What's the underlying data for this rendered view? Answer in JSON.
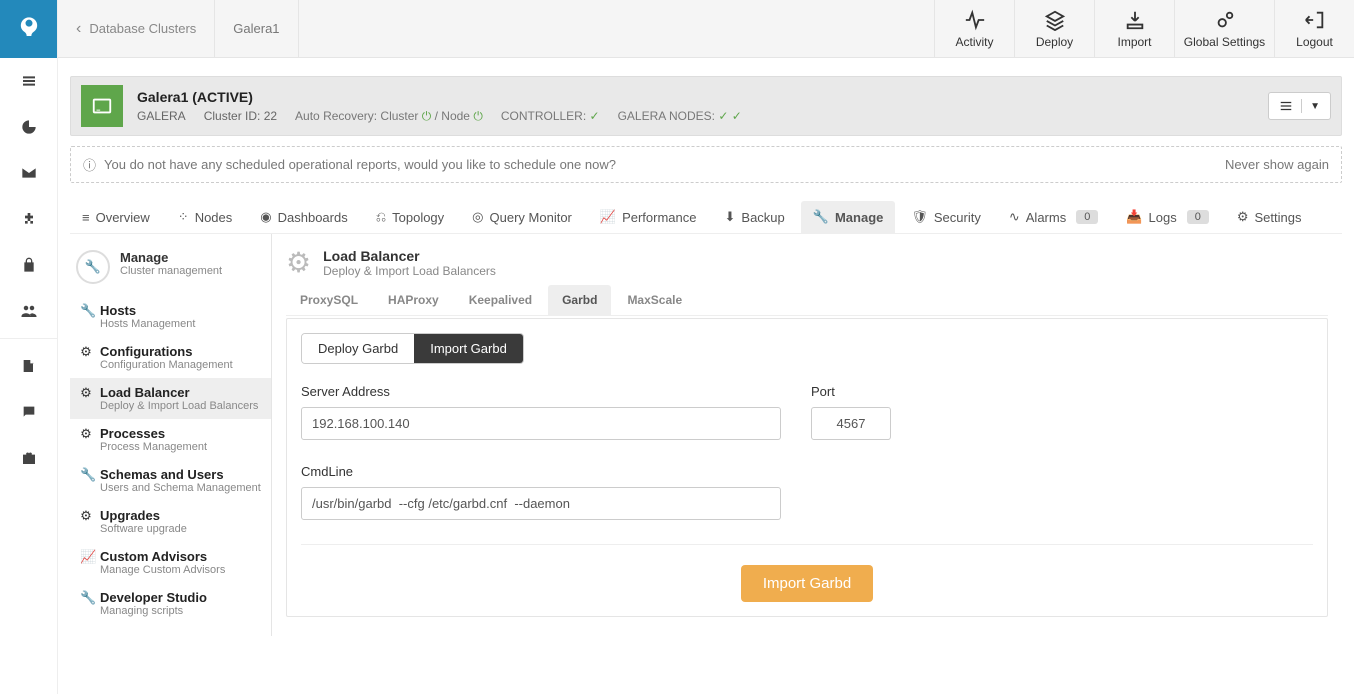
{
  "breadcrumb": {
    "root": "Database Clusters",
    "current": "Galera1"
  },
  "top_actions": {
    "activity": "Activity",
    "deploy": "Deploy",
    "import": "Import",
    "global_settings": "Global Settings",
    "logout": "Logout"
  },
  "cluster": {
    "title": "Galera1 (ACTIVE)",
    "type": "GALERA",
    "id_label": "Cluster ID: 22",
    "auto_recovery_label": "Auto Recovery: Cluster",
    "auto_recovery_sep": " / Node",
    "controller_label": "CONTROLLER:",
    "nodes_label": "GALERA NODES:"
  },
  "notice": {
    "text": "You do not have any scheduled operational reports, would you like to schedule one now?",
    "dismiss": "Never show again"
  },
  "tabs": {
    "overview": "Overview",
    "nodes": "Nodes",
    "dashboards": "Dashboards",
    "topology": "Topology",
    "query_monitor": "Query Monitor",
    "performance": "Performance",
    "backup": "Backup",
    "manage": "Manage",
    "security": "Security",
    "alarms": "Alarms",
    "alarms_count": "0",
    "logs": "Logs",
    "logs_count": "0",
    "settings": "Settings"
  },
  "manage_panel": {
    "title": "Manage",
    "subtitle": "Cluster management",
    "items": [
      {
        "title": "Hosts",
        "sub": "Hosts Management"
      },
      {
        "title": "Configurations",
        "sub": "Configuration Management"
      },
      {
        "title": "Load Balancer",
        "sub": "Deploy & Import Load Balancers"
      },
      {
        "title": "Processes",
        "sub": "Process Management"
      },
      {
        "title": "Schemas and Users",
        "sub": "Users and Schema Management"
      },
      {
        "title": "Upgrades",
        "sub": "Software upgrade"
      },
      {
        "title": "Custom Advisors",
        "sub": "Manage Custom Advisors"
      },
      {
        "title": "Developer Studio",
        "sub": "Managing scripts"
      }
    ]
  },
  "lb": {
    "title": "Load Balancer",
    "subtitle": "Deploy & Import Load Balancers",
    "subtabs": {
      "proxysql": "ProxySQL",
      "haproxy": "HAProxy",
      "keepalived": "Keepalived",
      "garbd": "Garbd",
      "maxscale": "MaxScale"
    },
    "pills": {
      "deploy": "Deploy Garbd",
      "import": "Import Garbd"
    },
    "form": {
      "server_label": "Server Address",
      "server_value": "192.168.100.140",
      "port_label": "Port",
      "port_value": "4567",
      "cmd_label": "CmdLine",
      "cmd_value": "/usr/bin/garbd  --cfg /etc/garbd.cnf  --daemon",
      "submit": "Import Garbd"
    }
  }
}
